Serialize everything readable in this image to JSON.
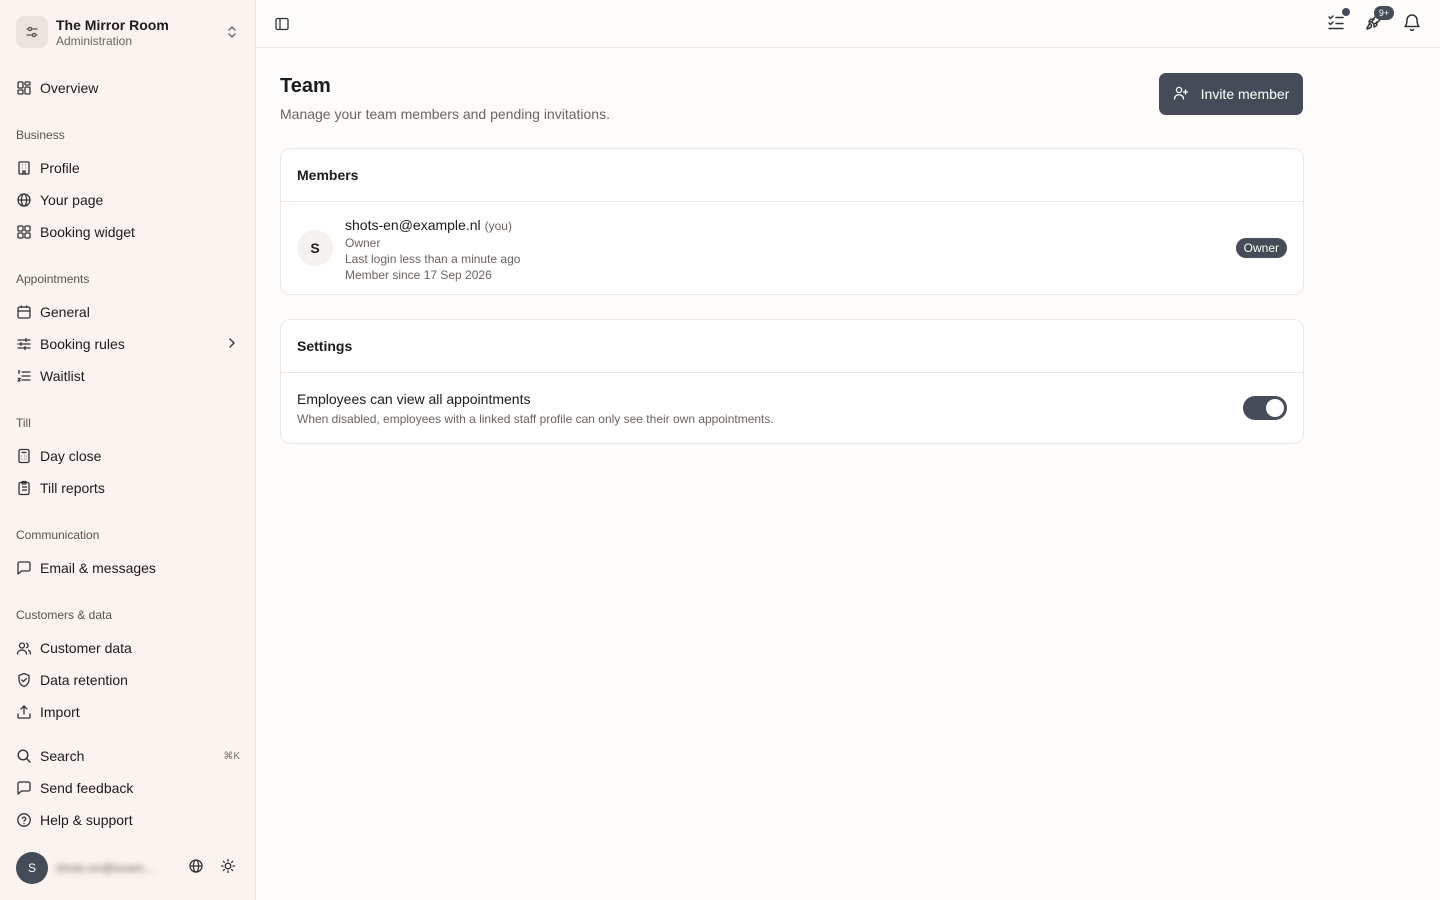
{
  "workspace": {
    "name": "The Mirror Room",
    "subtitle": "Administration"
  },
  "sidebar": {
    "overview": "Overview",
    "sections": {
      "business": "Business",
      "appointments": "Appointments",
      "till": "Till",
      "communication": "Communication",
      "customers": "Customers & data"
    },
    "items": {
      "profile": "Profile",
      "your_page": "Your page",
      "booking_widget": "Booking widget",
      "general": "General",
      "booking_rules": "Booking rules",
      "waitlist": "Waitlist",
      "day_close": "Day close",
      "till_reports": "Till reports",
      "email_messages": "Email & messages",
      "customer_data": "Customer data",
      "data_retention": "Data retention",
      "import": "Import"
    },
    "footer": {
      "search": "Search",
      "search_shortcut": "⌘K",
      "feedback": "Send feedback",
      "help": "Help & support"
    },
    "user": {
      "initial": "S",
      "email": "shots-en@exam..."
    }
  },
  "topbar": {
    "notification_badge": "9+"
  },
  "page": {
    "title": "Team",
    "subtitle": "Manage your team members and pending invitations.",
    "invite_label": "Invite member"
  },
  "members_card": {
    "title": "Members",
    "members": [
      {
        "initial": "S",
        "email": "shots-en@example.nl",
        "you_tag": "(you)",
        "role": "Owner",
        "last_login": "Last login less than a minute ago",
        "since": "Member since 17 Sep 2026",
        "badge": "Owner"
      }
    ]
  },
  "settings_card": {
    "title": "Settings",
    "employees_view_all": {
      "title": "Employees can view all appointments",
      "description": "When disabled, employees with a linked staff profile can only see their own appointments.",
      "enabled": true
    }
  },
  "colors": {
    "accent": "#464c57",
    "sidebar_bg": "#fbf3ef"
  }
}
